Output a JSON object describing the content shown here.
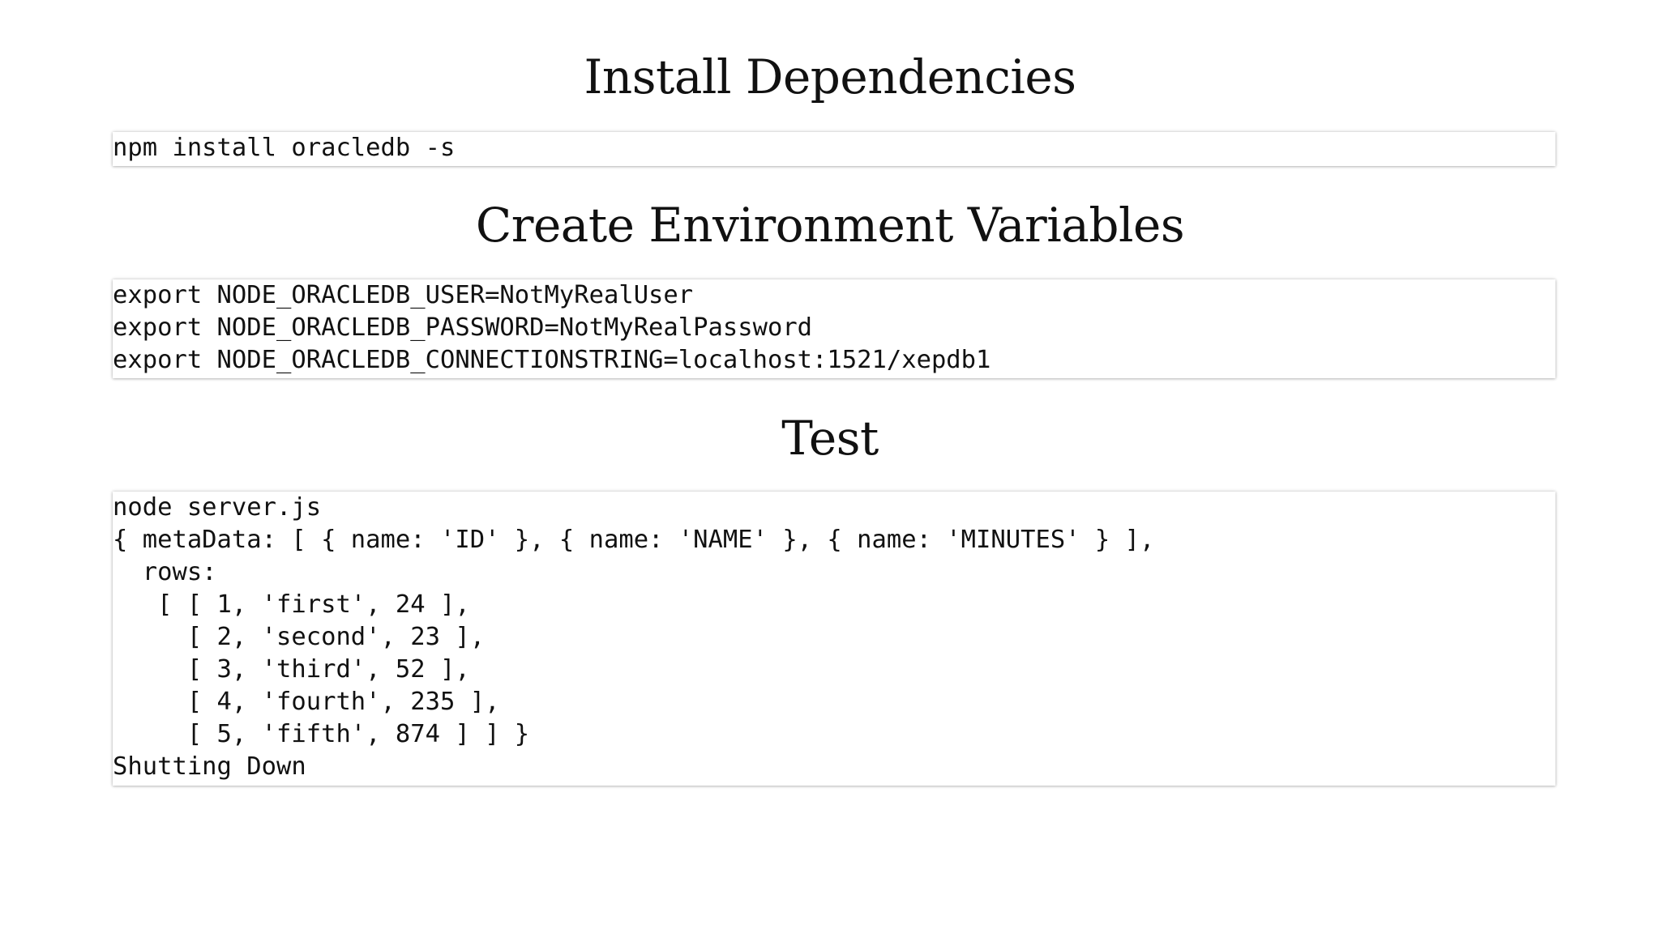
{
  "sections": {
    "install": {
      "heading": "Install Dependencies",
      "lines": [
        "npm install oracledb -s"
      ]
    },
    "env": {
      "heading": "Create Environment Variables",
      "lines": [
        "export NODE_ORACLEDB_USER=NotMyRealUser",
        "export NODE_ORACLEDB_PASSWORD=NotMyRealPassword",
        "export NODE_ORACLEDB_CONNECTIONSTRING=localhost:1521/xepdb1"
      ]
    },
    "test": {
      "heading": "Test",
      "lines": [
        "node server.js",
        "{ metaData: [ { name: 'ID' }, { name: 'NAME' }, { name: 'MINUTES' } ],",
        "  rows:",
        "   [ [ 1, 'first', 24 ],",
        "     [ 2, 'second', 23 ],",
        "     [ 3, 'third', 52 ],",
        "     [ 4, 'fourth', 235 ],",
        "     [ 5, 'fifth', 874 ] ] }",
        "Shutting Down"
      ]
    }
  }
}
